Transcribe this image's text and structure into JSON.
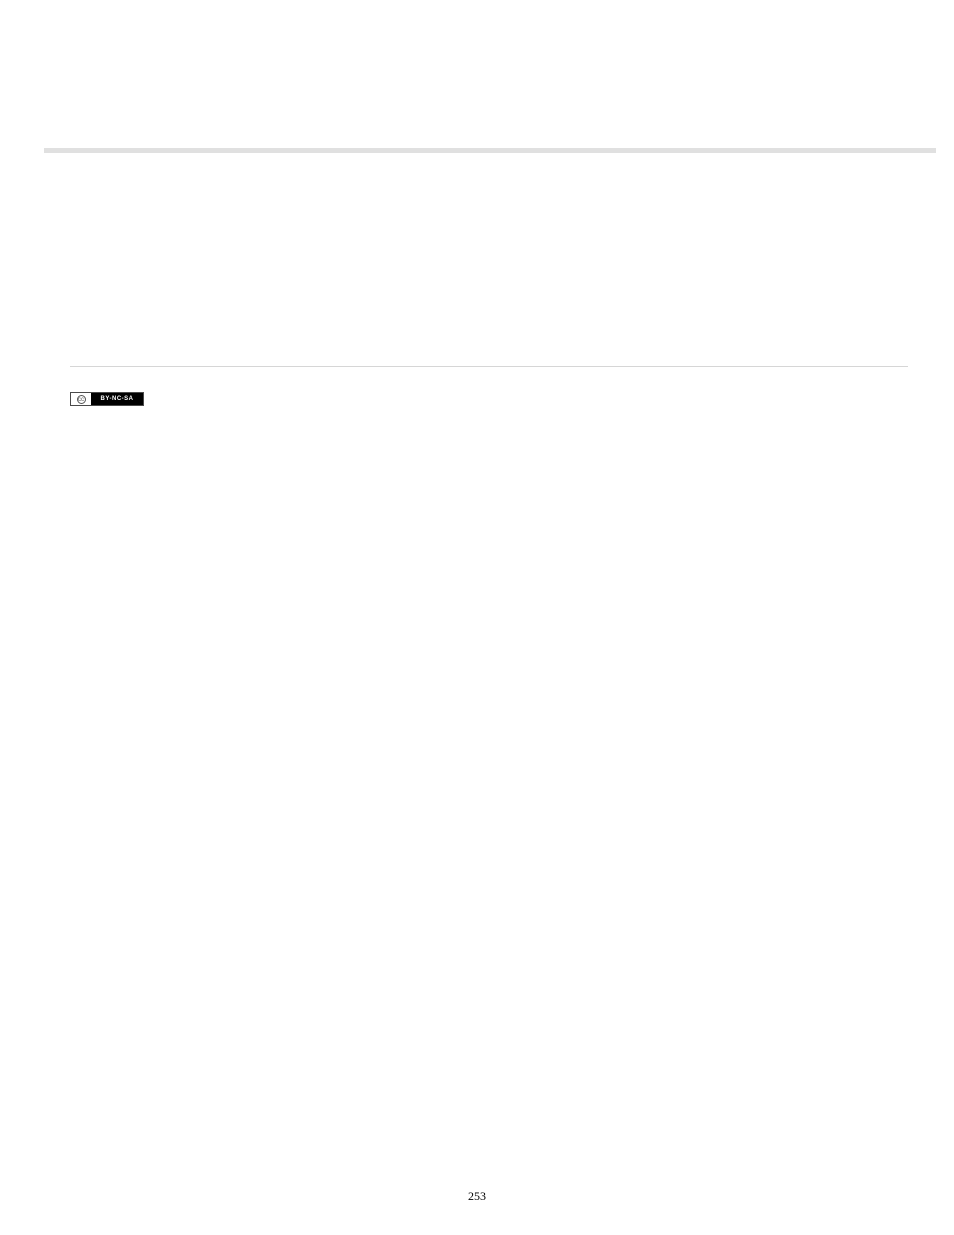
{
  "license": {
    "cc_symbol": "cc",
    "terms": "BY-NC-SA"
  },
  "page_number": "253"
}
